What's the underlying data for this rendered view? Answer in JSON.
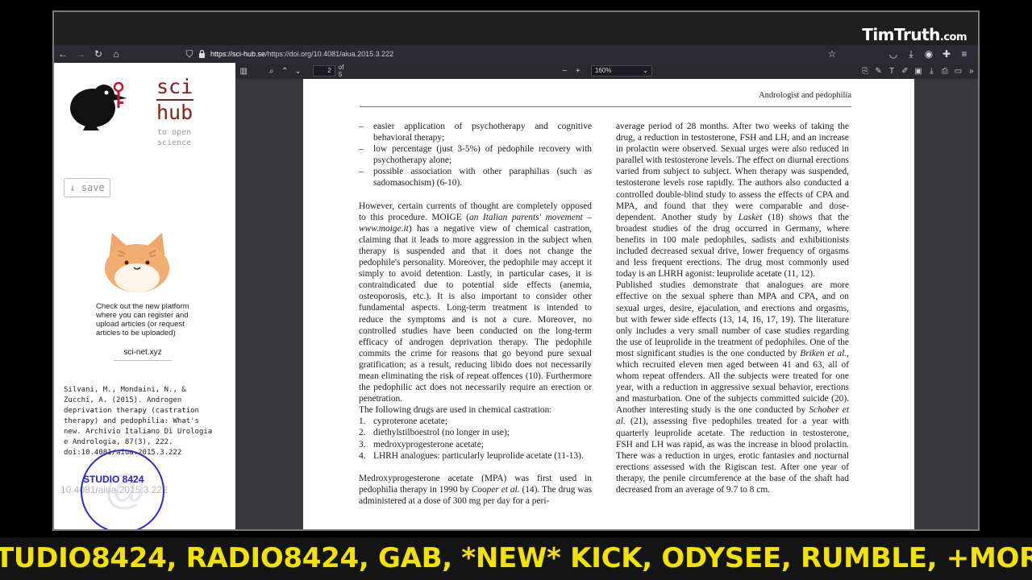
{
  "overlay": {
    "watermark_main": "TimTruth",
    "watermark_suffix": ".com",
    "ticker": "TUDIO8424, RADIO8424, GAB, *NEW* KICK, ODYSEE, RUMBLE, +MORE F",
    "studio_badge": "STUDIO 8424",
    "studio_at": "@"
  },
  "browser": {
    "url_host": "https://sci-hub.se",
    "url_path": "/https://doi.org/10.4081/aiua.2015.3.222",
    "icons": [
      "back-icon",
      "forward-icon",
      "reload-icon",
      "home-icon",
      "shield-icon",
      "lock-icon",
      "star-icon",
      "pocket-icon",
      "download-icon",
      "account-icon",
      "extensions-icon",
      "menu-icon"
    ]
  },
  "scihub": {
    "logo_top": "sci",
    "logo_bottom": "hub",
    "tagline_1": "to open",
    "tagline_2": "science",
    "save_label": "↓ save",
    "promo": "Check out the new platform where you can register and upload articles (or request articles to be uploaded)",
    "scinet_link": "sci-net.xyz",
    "citation": "Silvani, M., Mondaini, N., & Zucchi, A. (2015). Androgen deprivation therapy (castration therapy) and pedophilia: What's new. Archivio Italiano Di Urologia e Andrologia, 87(3), 222. doi:10.4081/aiua.2015.3.222",
    "doi_gray": "10.4081/aiua.2015.3.222",
    "collapse_arrow": "◀"
  },
  "pdf_toolbar": {
    "page_current": "2",
    "page_of": "of 5",
    "zoom": "160%"
  },
  "page": {
    "running_head": "Andrologist and pedophilia",
    "left": {
      "bullets": [
        "easier application of psychotherapy and cognitive behavioral therapy;",
        "low percentage (just 3-5%) of pedophile recovery with psychotherapy alone;",
        "possible association with other paraphilias (such as sadomasochism) (6-10)."
      ],
      "p1_a": "However, certain currents of thought are completely opposed to this procedure. MOIGE (",
      "p1_em": "an Italian parents' movement – www.moige.it",
      "p1_b": ") has a negative view of chemical castration, claiming that it leads to more aggression in the subject when therapy is suspended and that it does not change the pedophile's personality. Moreover, the pedophile may accept it simply to avoid detention. Lastly, in particular cases, it is contraindicated due to potential side effects (anemia, osteoporosis, etc.). It is also important to consider other fundamental aspects. Long-term treatment is intended to reduce the symptoms and is not a cure. Moreover, no controlled studies have been conducted on the long-term efficacy of androgen deprivation therapy. The pedophile commits the crime for reasons that go beyond pure sexual gratification; as a result, reducing libido does not necessarily mean eliminating the risk of repeat offences (10). Furthermore the pedophilic act does not necessarily require an erection or penetration.",
      "list_intro": "The following drugs are used in chemical castration:",
      "drugs": [
        {
          "n": "1.",
          "t": "cyproterone acetate;"
        },
        {
          "n": "2.",
          "t": "diethylstilboestrol (no longer in use);"
        },
        {
          "n": "3.",
          "t": "medroxyprogesterone acetate;"
        },
        {
          "n": "4.",
          "t": "LHRH analogues: particularly leuprolide acetate (11-13)."
        }
      ],
      "p2_a": "Medroxyprogesterone acetate (MPA) was first used in pedophilia therapy in 1990 by ",
      "p2_em": "Cooper et al.",
      "p2_b": " (14). The drug was administered at a dose of 300 mg per day for a peri-"
    },
    "right": {
      "p1_a": "average period of 28 months. After two weeks of taking the drug, a reduction in testosterone, FSH and LH, and an increase in prolactin were observed. Sexual urges were also reduced in parallel with testosterone levels. The effect on diurnal erections varied from subject to subject. When therapy was suspended, testosterone levels rose rapidly. The authors also conducted a controlled double-blind study to assess the effects of CPA and MPA, and found that they were comparable and dose-dependent. Another study by ",
      "p1_em": "Lasket",
      "p1_b": " (18) shows that the broadest studies of the drug occurred in Germany, where benefits in 100 male pedophiles, sadists and exhibitionists included decreased sexual drive, lower frequency of orgasms and less frequent erections. The drug most commonly used today is an LHRH agonist: leuprolide acetate (11, 12).",
      "p2_a": "Published studies demonstrate that analogues are more effective on the sexual sphere than MPA and CPA, and on sexual urges, desire, ejaculation, and erections and orgasms, but with fewer side effects (13, 14, 16, 17, 19). The literature only includes a very small number of case studies regarding the use of leuprolide in the treatment of pedophiles. One of the most significant studies is the one conducted by ",
      "p2_em1": "Briken et al.",
      "p2_b": ", which recruited eleven men aged between 41 and 63, all of whom repeat offenders. All the subjects were treated for one year, with a reduction in aggressive sexual behavior, erections and masturbation. One of the subjects committed suicide (20). Another interesting study is the one conducted by ",
      "p2_em2": "Schober et al.",
      "p2_c": " (21), assessing five pedophiles treated for a year with quarterly leuprolide acetate. The reduction in testosterone, FSH and LH was rapid, as was the increase in blood prolactin. There was a reduction in urges, erotic fantasies and nocturnal erections assessed with the Rigiscan test. After one year of therapy, the penile circumference at the base of the shaft had decreased from an average of 9.7 to 8 cm."
    }
  }
}
